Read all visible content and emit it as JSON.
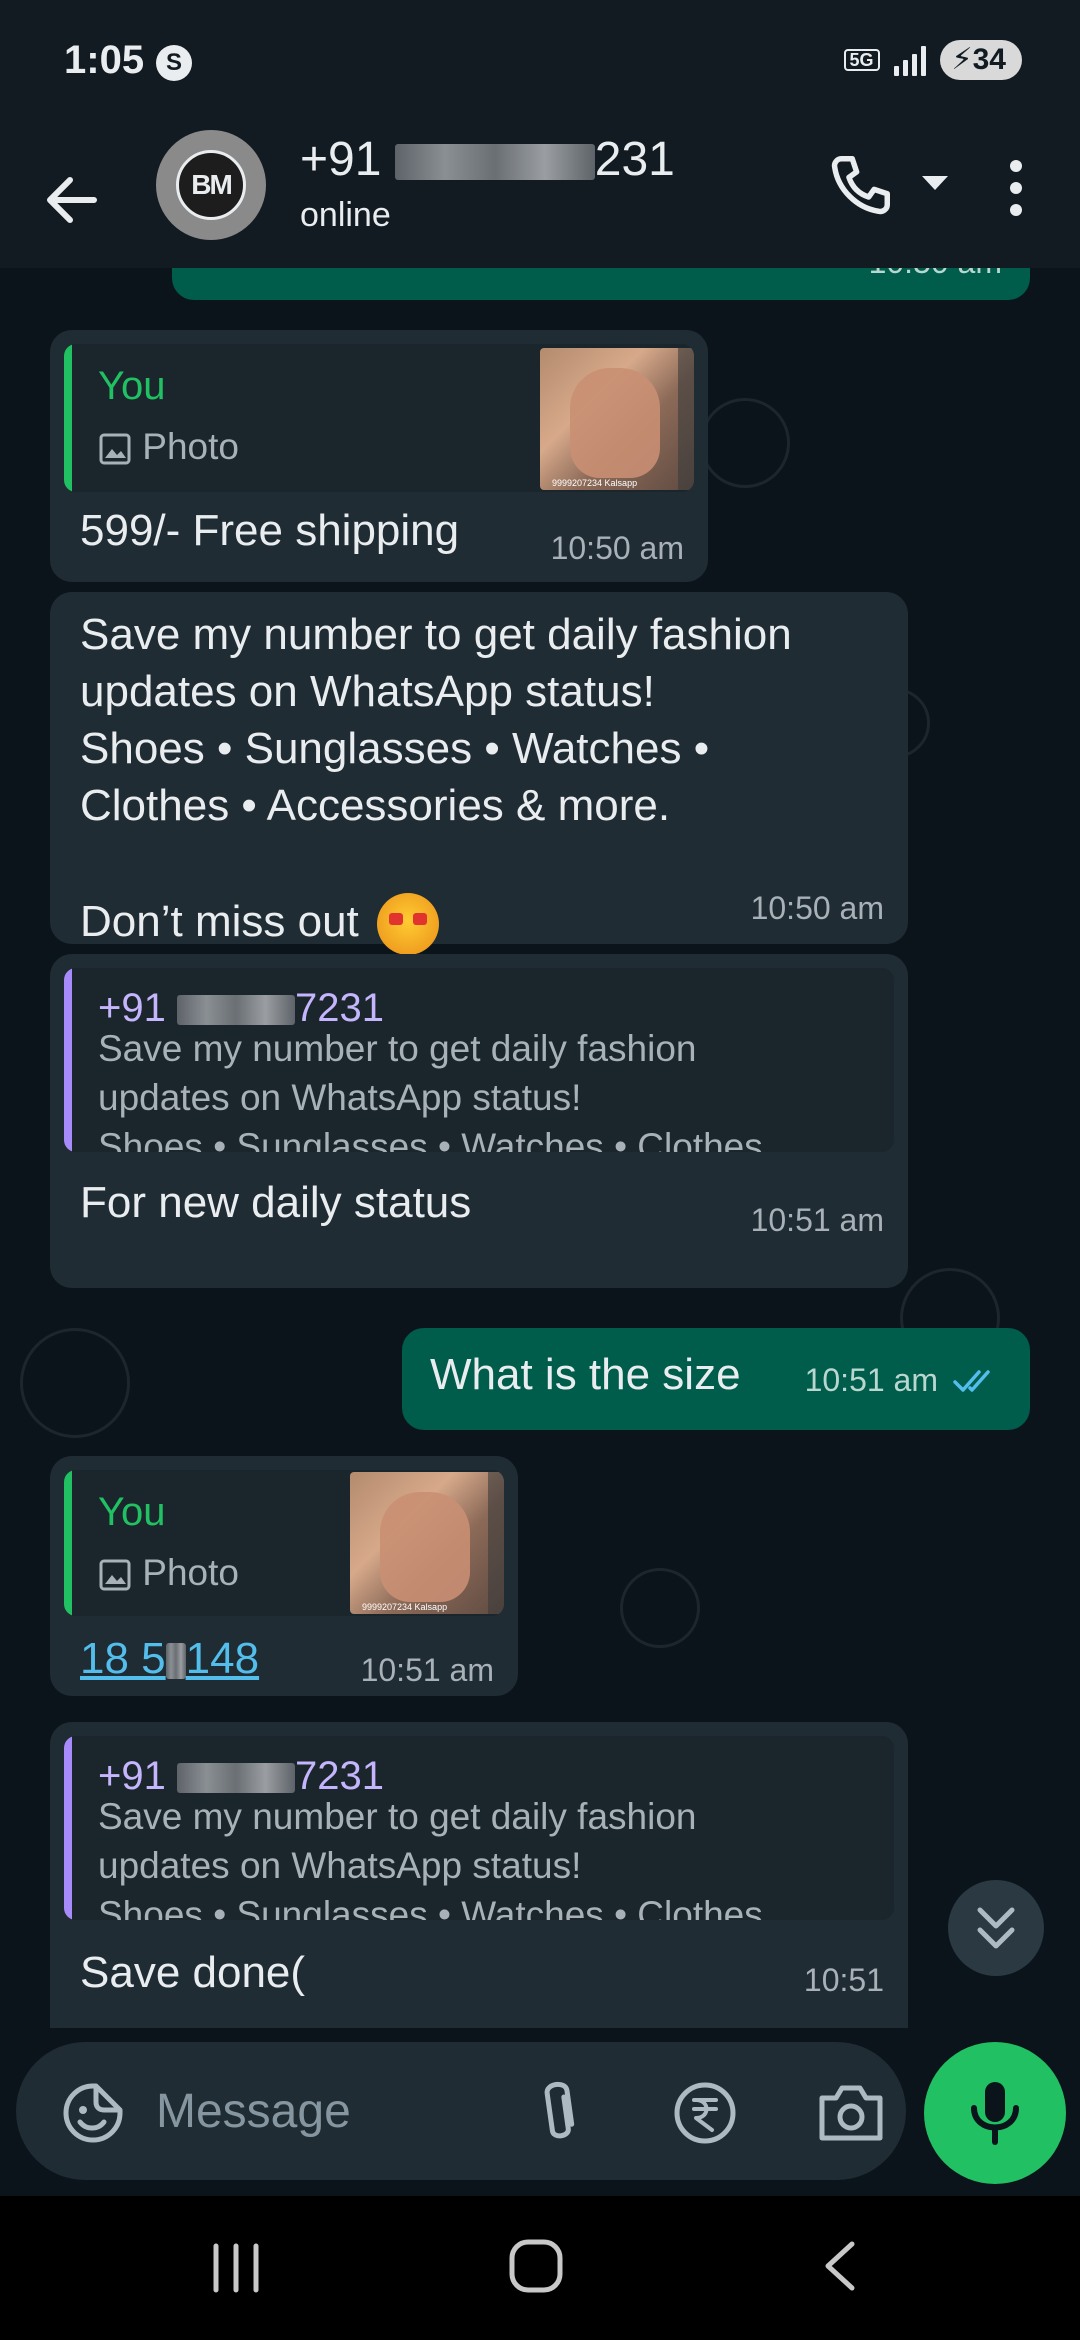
{
  "status_bar": {
    "time": "1:05",
    "status_icon_letter": "S",
    "network": "5G",
    "battery": "34"
  },
  "header": {
    "avatar_initials": "BM",
    "contact_prefix": "+91",
    "contact_suffix": "231",
    "status": "online"
  },
  "messages": [
    {
      "direction": "in",
      "quote": {
        "author": "You",
        "label": "Photo",
        "thumb_caption": "9999207234 Kalsapp"
      },
      "text": "599/- Free shipping",
      "time": "10:50 am"
    },
    {
      "direction": "in",
      "text": "Save my number to get daily fashion\nupdates on WhatsApp status!\nShoes • Sunglasses • Watches •\nClothes • Accessories & more.",
      "text_line2": "Don’t miss out",
      "emoji": "star-struck-emoji",
      "time": "10:50 am"
    },
    {
      "direction": "in",
      "quote": {
        "author_prefix": "+91",
        "author_suffix": "7231",
        "text": "Save my number to get daily fashion\nupdates on WhatsApp status!\nShoes • Sunglasses • Watches • Clothes…"
      },
      "text": "For new daily status",
      "time": "10:51 am"
    },
    {
      "direction": "out",
      "text": "What is the size",
      "time": "10:51 am",
      "read_status": "double-check-read"
    },
    {
      "direction": "in",
      "quote": {
        "author": "You",
        "label": "Photo",
        "thumb_caption": "9999207234 Kalsapp"
      },
      "link_prefix": "18 5",
      "link_suffix": "148",
      "time": "10:51 am"
    },
    {
      "direction": "in",
      "quote": {
        "author_prefix": "+91",
        "author_suffix": "7231",
        "text": "Save my number to get daily fashion\nupdates on WhatsApp status!\nShoes • Sunglasses • Watches • Clothes…"
      },
      "text": "Save done(",
      "time": "10:51"
    }
  ],
  "composer": {
    "placeholder": "Message"
  },
  "colors": {
    "accent_green": "#21c063",
    "outgoing_bubble": "#005c4b",
    "incoming_bubble": "#202c33",
    "quote_you": "#21c063",
    "quote_other": "#a78bfa",
    "read_ticks": "#53bdeb"
  }
}
